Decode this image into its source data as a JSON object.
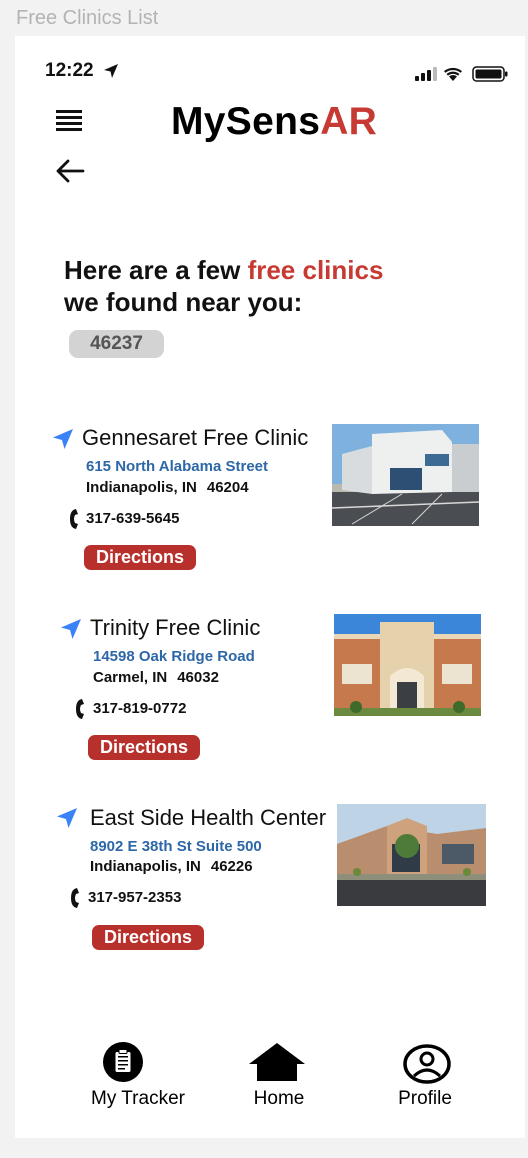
{
  "window": {
    "title": "Free Clinics List"
  },
  "status_bar": {
    "time": "12:22"
  },
  "header": {
    "logo_main": "MySens",
    "logo_accent": "AR"
  },
  "intro": {
    "line1_prefix": "Here are a few ",
    "line1_accent": "free clinics",
    "line2": "we found near you:",
    "zip": "46237"
  },
  "clinics": [
    {
      "name": "Gennesaret Free Clinic",
      "street": "615 North Alabama Street",
      "city": "Indianapolis, IN",
      "zip": "46204",
      "phone": "317-639-5645",
      "directions_label": "Directions"
    },
    {
      "name": "Trinity Free Clinic",
      "street": "14598 Oak Ridge Road",
      "city": "Carmel, IN",
      "zip": "46032",
      "phone": "317-819-0772",
      "directions_label": "Directions"
    },
    {
      "name": "East Side Health Center",
      "street": "8902 E 38th St Suite 500",
      "city": "Indianapolis, IN",
      "zip": "46226",
      "phone": "317-957-2353",
      "directions_label": "Directions"
    }
  ],
  "bottom_nav": {
    "tracker_label": "My Tracker",
    "home_label": "Home",
    "profile_label": "Profile"
  },
  "colors": {
    "accent": "#c63a33",
    "button": "#b8302c",
    "link": "#2d67a7",
    "nav_icon": "#3a82f7"
  },
  "icons": [
    "location-arrow-icon",
    "signal-icon",
    "wifi-icon",
    "battery-icon",
    "menu-icon",
    "back-arrow-icon",
    "navigation-icon",
    "phone-icon",
    "clipboard-icon",
    "home-icon",
    "profile-icon"
  ]
}
